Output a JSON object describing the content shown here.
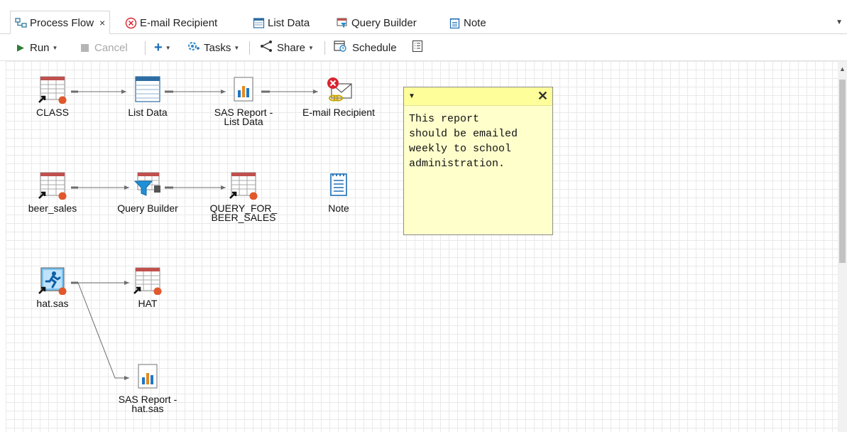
{
  "tabs": [
    {
      "label": "Process Flow",
      "icon": "process-flow-icon",
      "active": true,
      "close": "×"
    },
    {
      "label": "E-mail Recipient",
      "icon": "error-circle-icon"
    },
    {
      "label": "List Data",
      "icon": "list-data-icon"
    },
    {
      "label": "Query Builder",
      "icon": "query-builder-icon"
    },
    {
      "label": "Note",
      "icon": "note-icon"
    }
  ],
  "toolbar": {
    "run": "Run",
    "cancel": "Cancel",
    "add": "+",
    "tasks": "Tasks",
    "share": "Share",
    "schedule": "Schedule"
  },
  "nodes": {
    "class": "CLASS",
    "list_data": "List Data",
    "sas_report_list_data": "SAS Report -\nList Data",
    "email_recipient": "E-mail Recipient",
    "beer_sales": "beer_sales",
    "query_builder": "Query Builder",
    "query_for_beer_sales": "QUERY_FOR_\nBEER_SALES",
    "note": "Note",
    "hat_sas": "hat.sas",
    "hat": "HAT",
    "sas_report_hat": "SAS Report -\nhat.sas"
  },
  "sticky_note": {
    "text": "This report\nshould be emailed\nweekly to school\nadministration."
  },
  "colors": {
    "accent": "#1f77c8",
    "dataset_header": "#c0504d",
    "status_dot": "#e0582c",
    "error": "#d9232e",
    "note_bg": "#ffffcc"
  }
}
